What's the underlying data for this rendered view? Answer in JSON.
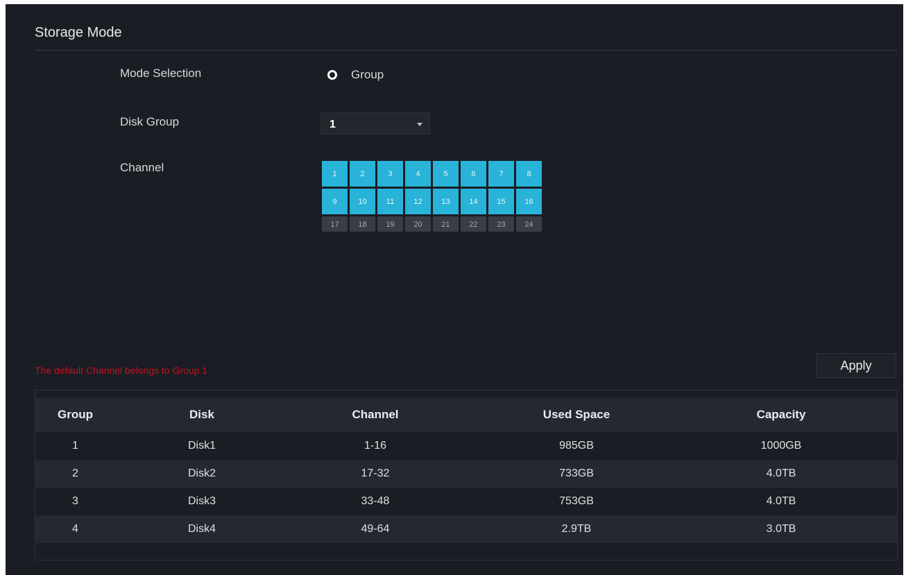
{
  "title": "Storage Mode",
  "mode_selection": {
    "label": "Mode Selection",
    "option": "Group"
  },
  "disk_group": {
    "label": "Disk Group",
    "value": "1"
  },
  "channel": {
    "label": "Channel",
    "cells": [
      "1",
      "2",
      "3",
      "4",
      "5",
      "6",
      "7",
      "8",
      "9",
      "10",
      "11",
      "12",
      "13",
      "14",
      "15",
      "16",
      "17",
      "18",
      "19",
      "20",
      "21",
      "22",
      "23",
      "24"
    ],
    "selected_count": 16
  },
  "note": "The default Channel belongs to Group 1",
  "apply_label": "Apply",
  "table": {
    "headers": [
      "Group",
      "Disk",
      "Channel",
      "Used Space",
      "Capacity"
    ],
    "rows": [
      [
        "1",
        "Disk1",
        "1-16",
        "985GB",
        "1000GB"
      ],
      [
        "2",
        "Disk2",
        "17-32",
        "733GB",
        "4.0TB"
      ],
      [
        "3",
        "Disk3",
        "33-48",
        "753GB",
        "4.0TB"
      ],
      [
        "4",
        "Disk4",
        "49-64",
        "2.9TB",
        "3.0TB"
      ]
    ]
  },
  "colors": {
    "selected_channel": "#29b3d8",
    "unselected_channel": "#3a3d44",
    "note_red": "#c8101e",
    "panel_bg": "#1a1d23"
  }
}
